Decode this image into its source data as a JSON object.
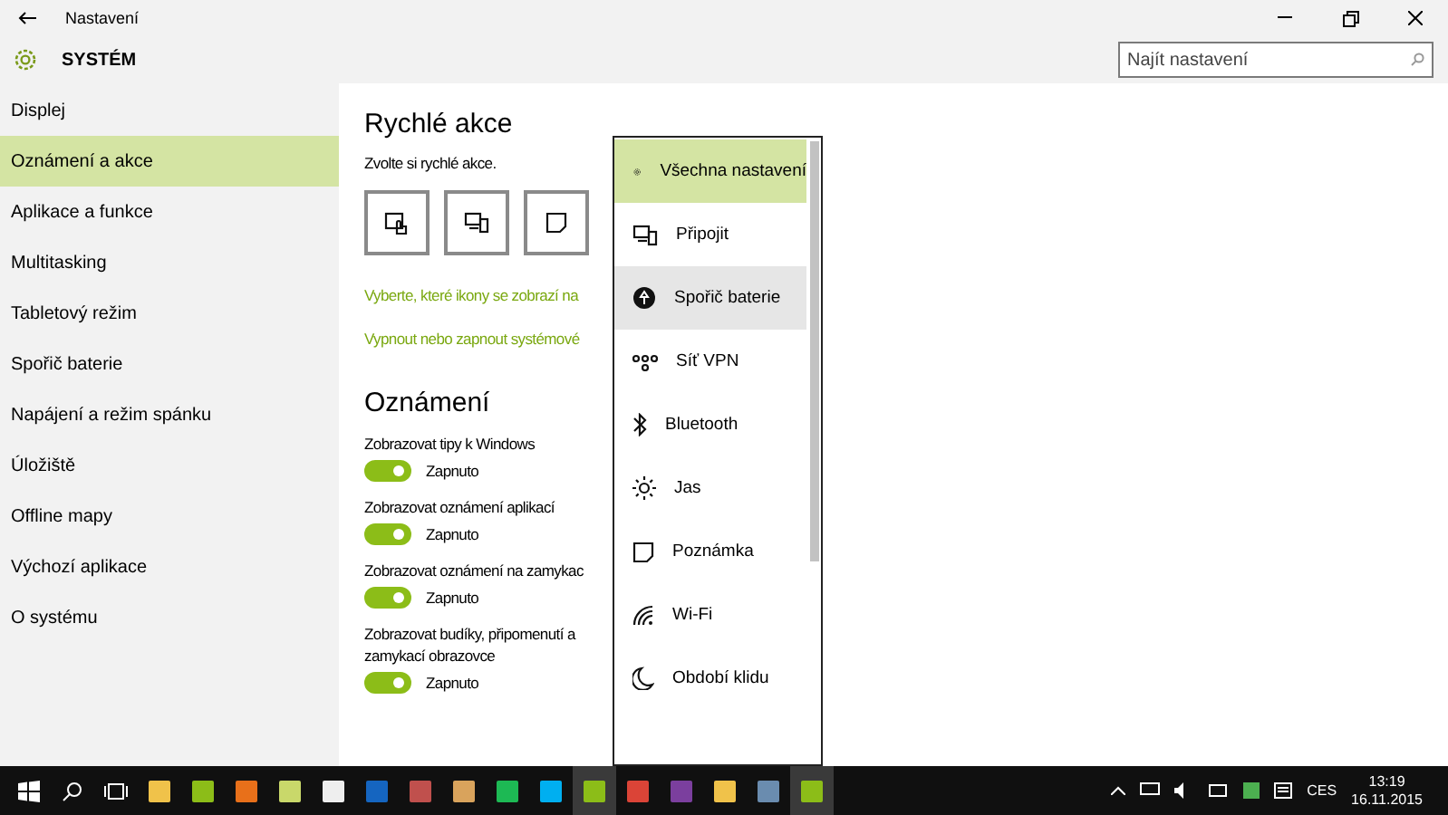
{
  "window": {
    "title": "Nastavení"
  },
  "header": {
    "title": "SYSTÉM",
    "search": {
      "placeholder": "Najít nastavení"
    }
  },
  "sidebar": {
    "items": [
      {
        "label": "Displej",
        "selected": false
      },
      {
        "label": "Oznámení a akce",
        "selected": true
      },
      {
        "label": "Aplikace a funkce",
        "selected": false
      },
      {
        "label": "Multitasking",
        "selected": false
      },
      {
        "label": "Tabletový režim",
        "selected": false
      },
      {
        "label": "Spořič baterie",
        "selected": false
      },
      {
        "label": "Napájení a režim spánku",
        "selected": false
      },
      {
        "label": "Úložiště",
        "selected": false
      },
      {
        "label": "Offline mapy",
        "selected": false
      },
      {
        "label": "Výchozí aplikace",
        "selected": false
      },
      {
        "label": "O systému",
        "selected": false
      }
    ]
  },
  "quick_actions": {
    "heading": "Rychlé akce",
    "subtitle": "Zvolte si rychlé akce.",
    "tiles": [
      {
        "kind": "tablet"
      },
      {
        "kind": "connect"
      },
      {
        "kind": "note"
      }
    ],
    "links": [
      "Vyberte, které ikony se zobrazí na",
      "Vypnout nebo zapnout systémové"
    ]
  },
  "notifications": {
    "heading": "Oznámení",
    "settings": [
      {
        "label": "Zobrazovat tipy k Windows",
        "on": true,
        "state": "Zapnuto"
      },
      {
        "label": "Zobrazovat oznámení aplikací",
        "on": true,
        "state": "Zapnuto"
      },
      {
        "label": "Zobrazovat oznámení na zamykac",
        "on": true,
        "state": "Zapnuto"
      },
      {
        "label": "Zobrazovat budíky, připomenutí a",
        "label_2": "zamykací obrazovce",
        "on": true,
        "state": "Zapnuto"
      }
    ]
  },
  "dropdown": {
    "items": [
      {
        "kind": "gear",
        "label": "Všechna nastavení",
        "selected": true,
        "hovered": false
      },
      {
        "kind": "connect",
        "label": "Připojit",
        "selected": false,
        "hovered": false
      },
      {
        "kind": "battery",
        "label": "Spořič baterie",
        "selected": false,
        "hovered": true
      },
      {
        "kind": "vpn",
        "label": "Síť VPN",
        "selected": false,
        "hovered": false
      },
      {
        "kind": "bluetooth",
        "label": "Bluetooth",
        "selected": false,
        "hovered": false
      },
      {
        "kind": "sun",
        "label": "Jas",
        "selected": false,
        "hovered": false
      },
      {
        "kind": "note",
        "label": "Poznámka",
        "selected": false,
        "hovered": false
      },
      {
        "kind": "wifi",
        "label": "Wi-Fi",
        "selected": false,
        "hovered": false
      },
      {
        "kind": "moon",
        "label": "Období klidu",
        "selected": false,
        "hovered": false
      }
    ]
  },
  "taskbar": {
    "language": "CES",
    "time": "13:19",
    "date": "16.11.2015"
  }
}
